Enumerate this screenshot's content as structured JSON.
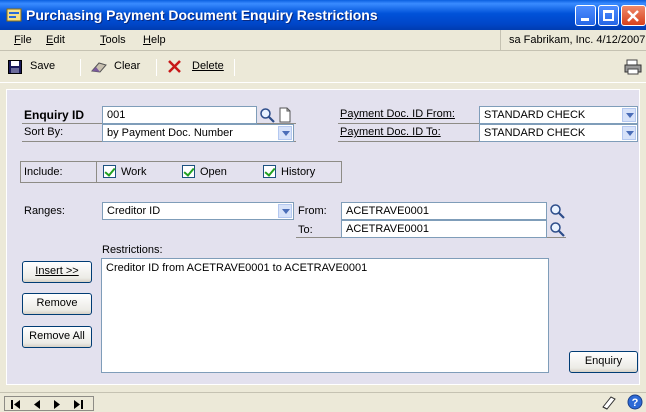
{
  "window": {
    "title": "Purchasing Payment Document Enquiry Restrictions"
  },
  "menu": {
    "items": [
      {
        "underline": "F",
        "rest": "ile"
      },
      {
        "underline": "E",
        "rest": "dit"
      },
      {
        "underline": "T",
        "rest": "ools"
      },
      {
        "underline": "H",
        "rest": "elp"
      }
    ],
    "user_info": "sa  Fabrikam, Inc.  4/12/2007"
  },
  "toolbar": {
    "save_label": "Save",
    "clear_label": "Clear",
    "delete_label": "Delete"
  },
  "form": {
    "enquiry_id_label": "Enquiry ID",
    "enquiry_id_value": "001",
    "sort_by_label": "Sort By:",
    "sort_by_value": "by Payment Doc. Number",
    "payment_doc_from_label": "Payment Doc. ID From:",
    "payment_doc_from_value": "STANDARD CHECK",
    "payment_doc_to_label": "Payment Doc. ID To:",
    "payment_doc_to_value": "STANDARD CHECK",
    "include_label": "Include:",
    "include_options": [
      {
        "label": "Work",
        "checked": true
      },
      {
        "label": "Open",
        "checked": true
      },
      {
        "label": "History",
        "checked": true
      }
    ],
    "ranges_label": "Ranges:",
    "ranges_value": "Creditor ID",
    "from_label": "From:",
    "from_value": "ACETRAVE0001",
    "to_label": "To:",
    "to_value": "ACETRAVE0001",
    "restrictions_label": "Restrictions:",
    "restrictions": [
      "Creditor ID from ACETRAVE0001 to ACETRAVE0001"
    ],
    "insert_label": "Insert >>",
    "remove_label": "Remove",
    "remove_all_label": "Remove All",
    "enquiry_button_label": "Enquiry"
  },
  "colors": {
    "titlebar": "#0052d9",
    "panel": "#e3e1ee",
    "window": "#ece9d8"
  }
}
